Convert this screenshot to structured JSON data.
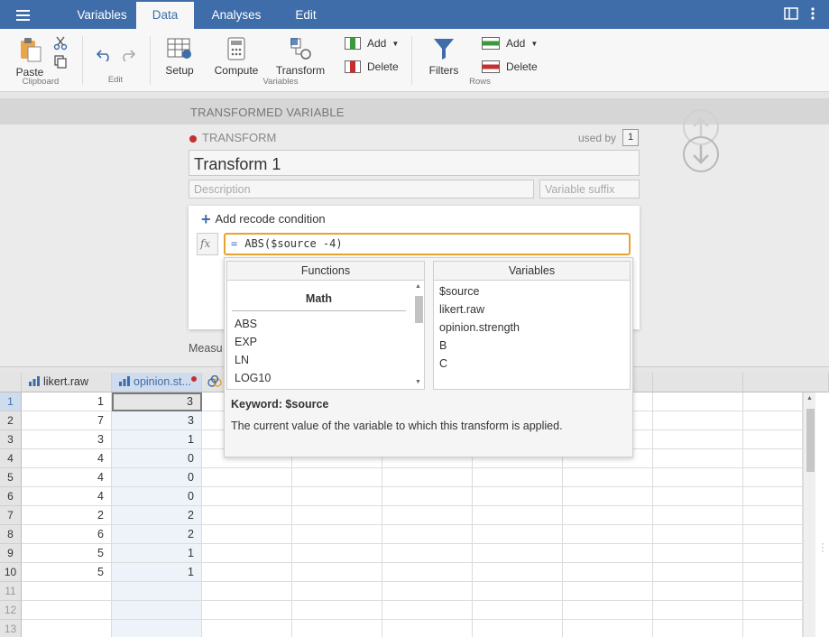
{
  "menu": {
    "tabs": [
      "Variables",
      "Data",
      "Analyses",
      "Edit"
    ],
    "active_tab": "Data"
  },
  "ribbon": {
    "paste": "Paste",
    "clipboard_group": "Clipboard",
    "edit_group": "Edit",
    "setup": "Setup",
    "compute": "Compute",
    "transform": "Transform",
    "variables_group": "Variables",
    "add_var": "Add",
    "delete_var": "Delete",
    "filters": "Filters",
    "add_row": "Add",
    "delete_row": "Delete",
    "rows_group": "Rows"
  },
  "editor": {
    "section_title": "TRANSFORMED VARIABLE",
    "subtitle": "TRANSFORM",
    "used_by_label": "used by",
    "used_by_count": "1",
    "name": "Transform 1",
    "description_placeholder": "Description",
    "suffix_placeholder": "Variable suffix",
    "add_recode": "Add recode condition",
    "formula_eq": "=",
    "formula": "ABS($source -4)",
    "measure_label": "Measu"
  },
  "picker": {
    "functions_header": "Functions",
    "variables_header": "Variables",
    "category": "Math",
    "functions": [
      "ABS",
      "EXP",
      "LN",
      "LOG10"
    ],
    "variables": [
      "$source",
      "likert.raw",
      "opinion.strength",
      "B",
      "C"
    ],
    "keyword": "Keyword: $source",
    "keyword_desc": "The current value of the variable to which this transform is applied."
  },
  "sheet": {
    "columns": [
      "likert.raw",
      "opinion.st..."
    ],
    "rows": [
      {
        "n": "1",
        "a": "1",
        "b": "3"
      },
      {
        "n": "2",
        "a": "7",
        "b": "3"
      },
      {
        "n": "3",
        "a": "3",
        "b": "1"
      },
      {
        "n": "4",
        "a": "4",
        "b": "0"
      },
      {
        "n": "5",
        "a": "4",
        "b": "0"
      },
      {
        "n": "6",
        "a": "4",
        "b": "0"
      },
      {
        "n": "7",
        "a": "2",
        "b": "2"
      },
      {
        "n": "8",
        "a": "6",
        "b": "2"
      },
      {
        "n": "9",
        "a": "5",
        "b": "1"
      },
      {
        "n": "10",
        "a": "5",
        "b": "1"
      }
    ],
    "empty_rows": [
      "11",
      "12",
      "13"
    ]
  },
  "colors": {
    "accent": "#3e6da9",
    "formula_border": "#e6a330",
    "status_dot": "#c43030"
  }
}
